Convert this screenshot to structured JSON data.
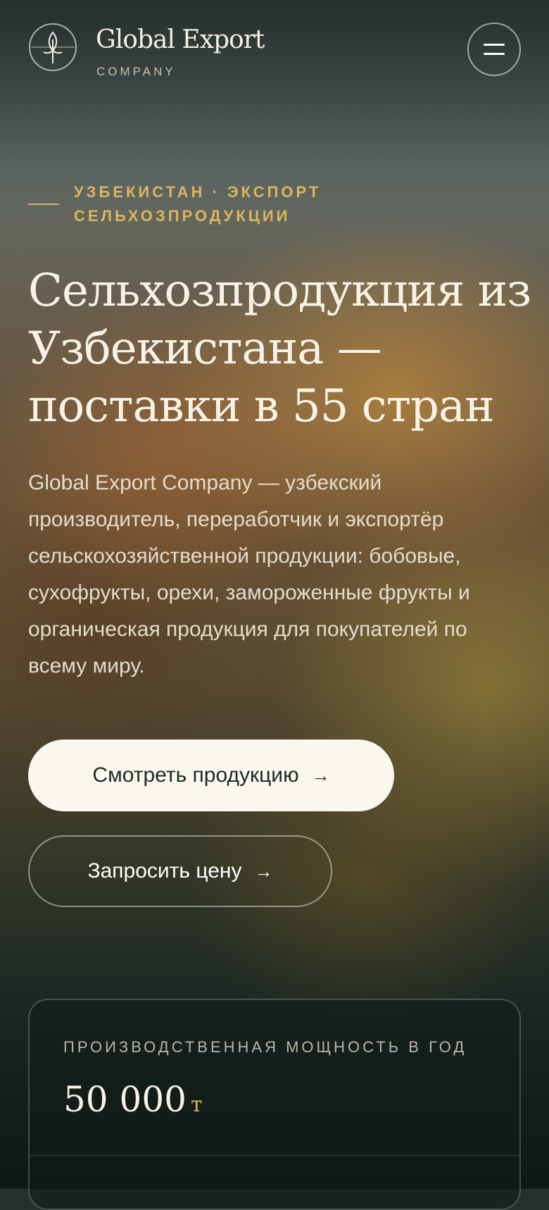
{
  "header": {
    "brand_name": "Global Export",
    "brand_sub": "COMPANY",
    "logo_icon": "wheat-icon",
    "menu_icon": "menu-icon"
  },
  "hero": {
    "eyebrow": "УЗБЕКИСТАН · ЭКСПОРТ СЕЛЬХОЗПРОДУКЦИИ",
    "headline": "Сельхозпродукция из Узбекистана — поставки в 55 стран",
    "lead": "Global Export Company — узбекский производитель, переработчик и экспортёр сельскохозяйственной продукции: бобовые, сухофрукты, орехи, замороженные фрукты и органическая продукция для покупателей по всему миру.",
    "primary_button": "Смотреть продукцию",
    "secondary_button": "Запросить цену",
    "arrow": "→"
  },
  "stats": {
    "label": "ПРОИЗВОДСТВЕННАЯ МОЩНОСТЬ В ГОД",
    "value": "50 000",
    "unit": "т"
  },
  "colors": {
    "accent": "#d7b45a",
    "button_bg": "#faf7ef",
    "button_text": "#1b2b25"
  }
}
